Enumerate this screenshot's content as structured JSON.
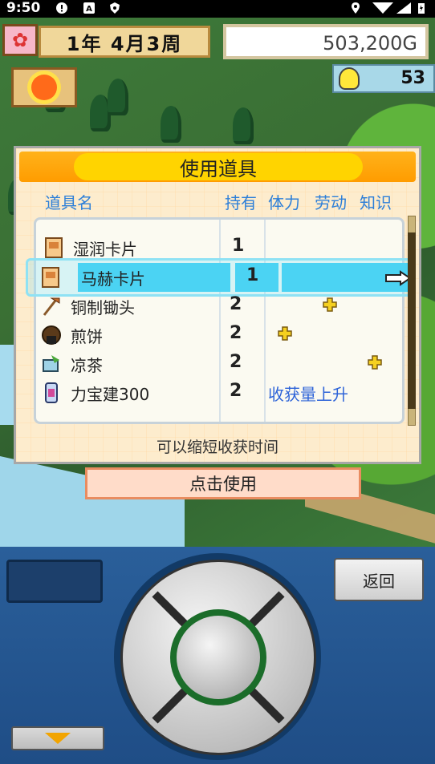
{
  "status_bar": {
    "time": "9:50"
  },
  "hud": {
    "date": "1年 4月3周",
    "money": "503,200G",
    "idea_points": "53"
  },
  "dialog": {
    "title": "使用道具",
    "columns": {
      "name": "道具名",
      "owned": "持有",
      "stamina": "体力",
      "labor": "劳动",
      "knowledge": "知识"
    },
    "items": [
      {
        "name": "湿润卡片",
        "count": "1",
        "icon": "card-icon"
      },
      {
        "name": "马赫卡片",
        "count": "1",
        "icon": "card-icon",
        "selected": true
      },
      {
        "name": "铜制锄头",
        "count": "2",
        "icon": "hoe-icon",
        "bonus": "labor"
      },
      {
        "name": "煎饼",
        "count": "2",
        "icon": "rice-cracker-icon",
        "bonus": "stamina"
      },
      {
        "name": "凉茶",
        "count": "2",
        "icon": "tea-icon",
        "bonus": "knowledge"
      },
      {
        "name": "力宝建300",
        "count": "2",
        "icon": "drink-can-icon",
        "effect": "收获量上升"
      }
    ],
    "description": "可以缩短收获时间",
    "use_button": "点击使用"
  },
  "controller": {
    "back_button": "返回"
  },
  "colors": {
    "accent_orange": "#ff9c00",
    "selection_cyan": "#4bd3f3",
    "column_blue": "#2d7fd8"
  }
}
